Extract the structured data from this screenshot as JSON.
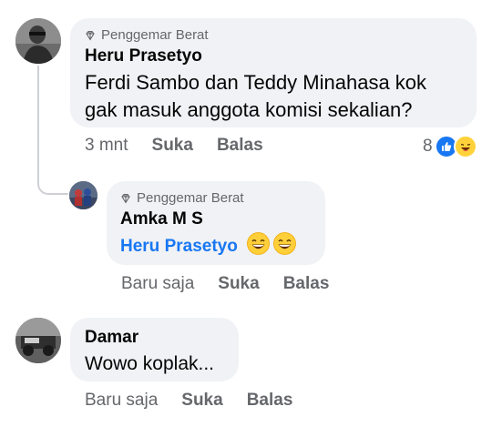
{
  "comments": [
    {
      "badge": "Penggemar Berat",
      "author": "Heru Prasetyo",
      "text_line1": "Ferdi Sambo dan Teddy Minahasa kok",
      "text_line2": "gak masuk anggota komisi sekalian?",
      "time": "3 mnt",
      "like_label": "Suka",
      "reply_label": "Balas",
      "reaction_count": "8"
    },
    {
      "badge": "Penggemar Berat",
      "author": "Amka M S",
      "mention": "Heru Prasetyo",
      "time": "Baru saja",
      "like_label": "Suka",
      "reply_label": "Balas"
    },
    {
      "author": "Damar",
      "text": "Wowo koplak...",
      "time": "Baru saja",
      "like_label": "Suka",
      "reply_label": "Balas"
    }
  ],
  "colors": {
    "mention": "#1877f2",
    "bubble": "#f0f2f5",
    "meta": "#65676b",
    "like_blue": "#1877f2",
    "haha_yellow": "#ffd23b"
  },
  "icons": [
    "diamond-badge-icon",
    "like-reaction-icon",
    "haha-reaction-icon",
    "grinning-emoji-icon"
  ]
}
